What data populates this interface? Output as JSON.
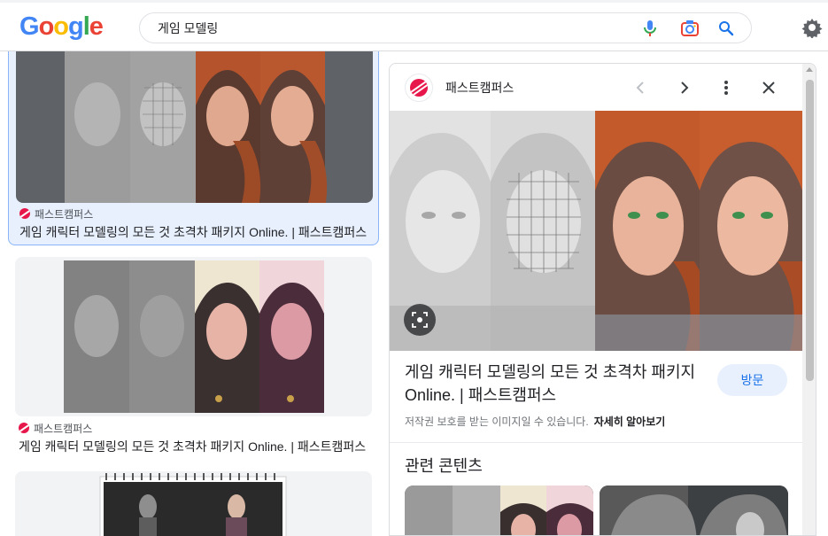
{
  "header": {
    "logo_letters": [
      "G",
      "o",
      "o",
      "g",
      "l",
      "e"
    ],
    "logo_colors": [
      "#4285f4",
      "#ea4335",
      "#fbbc05",
      "#4285f4",
      "#34a853",
      "#ea4335"
    ],
    "search_query": "게임 모델링",
    "icons": [
      "mic-icon",
      "camera-lens-icon",
      "search-icon",
      "gear-icon"
    ]
  },
  "results": [
    {
      "source": "패스트캠퍼스",
      "title": "게임 캐릭터 모델링의 모든 것 초격차 패키지 Online. | 패스트캠퍼스",
      "selected": true
    },
    {
      "source": "패스트캠퍼스",
      "title": "게임 캐릭터 모델링의 모든 것 초격차 패키지 Online. | 패스트캠퍼스",
      "selected": false
    }
  ],
  "panel": {
    "site_name": "패스트캠퍼스",
    "title": "게임 캐릭터 모델링의 모든 것 초격차 패키지 Online. | 패스트캠퍼스",
    "visit_label": "방문",
    "copyright_note": "저작권 보호를 받는 이미지일 수 있습니다.",
    "learn_more": "자세히 알아보기",
    "related_heading": "관련 콘텐츠"
  },
  "colors": {
    "accent": "#1a73e8",
    "favicon": "#e8174b",
    "selected_border": "#8ab4f8"
  }
}
